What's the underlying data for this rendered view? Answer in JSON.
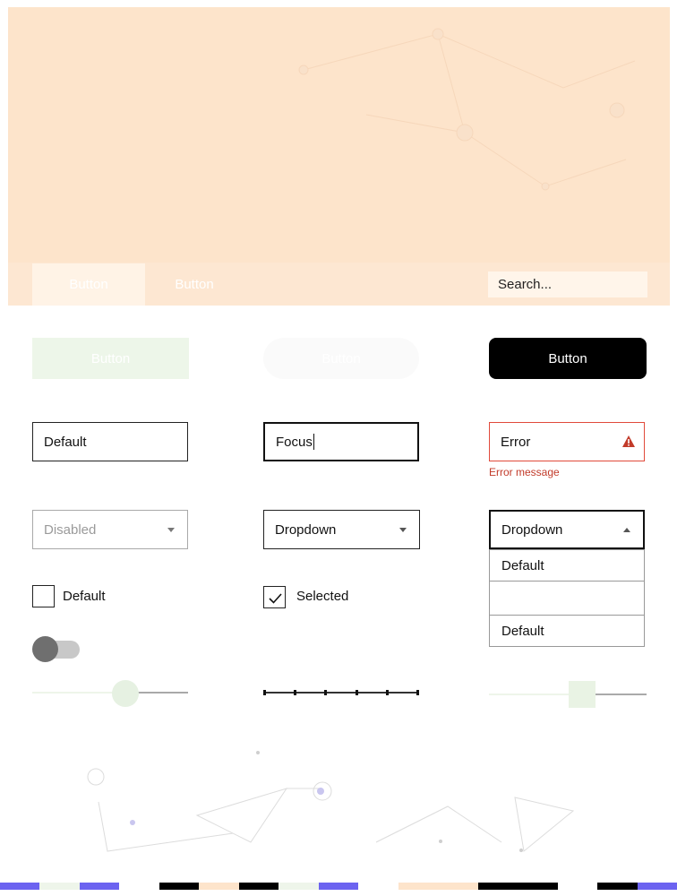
{
  "hero": {
    "tabs": [
      {
        "label": "Button"
      },
      {
        "label": "Button"
      }
    ],
    "search": {
      "placeholder": "Search..."
    }
  },
  "buttons": {
    "ghost": "Button",
    "pill": "Button",
    "primary": "Button"
  },
  "inputs": {
    "default_value": "Default",
    "focus_value": "Focus",
    "error_value": "Error",
    "error_message": "Error message"
  },
  "dropdowns": {
    "disabled": "Disabled",
    "normal": "Dropdown",
    "open": "Dropdown",
    "options": [
      "Default",
      "",
      "Default"
    ]
  },
  "checkboxes": {
    "default_label": "Default",
    "selected_label": "Selected"
  },
  "toggle": {
    "on": false
  },
  "sliders": {
    "slider1_value": 0.6,
    "slider2_steps": 6,
    "slider3_value": 0.6
  },
  "palette": [
    "#6c63f0",
    "#eef5ea",
    "#6c63f0",
    "#ffffff",
    "#000000",
    "#fde4cb",
    "#000000",
    "#eef5ea",
    "#6c63f0",
    "#ffffff",
    "#fde4cb",
    "#fde4cb",
    "#000000",
    "#000000",
    "#ffffff",
    "#000000",
    "#6c63f0"
  ],
  "colors": {
    "hero_bg": "#fde4cb",
    "primary": "#000000",
    "error": "#e14a3b",
    "accent": "#6c63f0"
  }
}
